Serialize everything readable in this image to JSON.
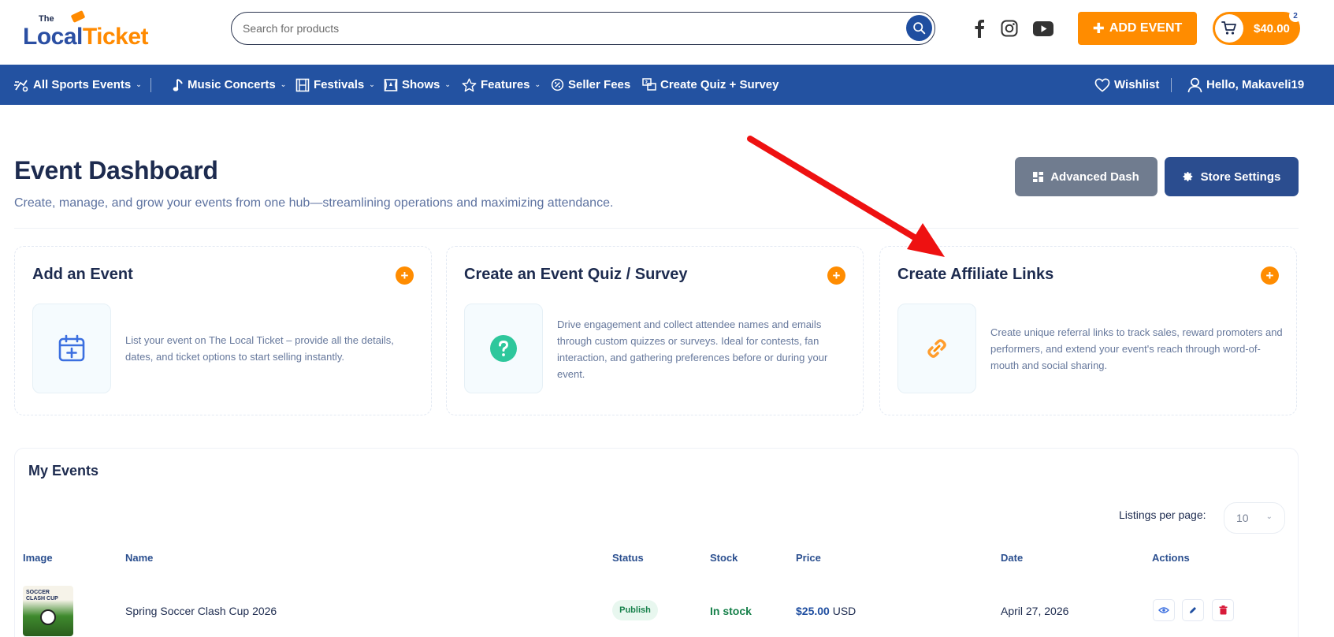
{
  "header": {
    "logo_the": "The",
    "logo_local": "Local",
    "logo_ticket": "Ticket",
    "search_placeholder": "Search for products",
    "add_event_label": "ADD EVENT",
    "cart_amount": "$40.00",
    "cart_count": "2"
  },
  "nav": {
    "items": [
      {
        "label": "All Sports Events",
        "icon": "sports-icon",
        "dropdown": true
      },
      {
        "label": "Music Concerts",
        "icon": "music-note-icon",
        "dropdown": true
      },
      {
        "label": "Festivals",
        "icon": "film-icon",
        "dropdown": true
      },
      {
        "label": "Shows",
        "icon": "theater-icon",
        "dropdown": true
      },
      {
        "label": "Features",
        "icon": "star-icon",
        "dropdown": true
      },
      {
        "label": "Seller Fees",
        "icon": "badge-icon",
        "dropdown": false
      },
      {
        "label": "Create Quiz + Survey",
        "icon": "quiz-icon",
        "dropdown": false
      }
    ],
    "wishlist_label": "Wishlist",
    "user_label": "Hello, Makaveli19"
  },
  "page": {
    "title": "Event Dashboard",
    "subtitle": "Create, manage, and grow your events from one hub—streamlining operations and maximizing attendance.",
    "advanced_dash_label": "Advanced Dash",
    "store_settings_label": "Store Settings"
  },
  "cards": [
    {
      "title": "Add an Event",
      "description": "List your event on The Local Ticket – provide all the details, dates, and ticket options to start selling instantly.",
      "icon": "calendar-plus-icon"
    },
    {
      "title": "Create an Event Quiz / Survey",
      "description": "Drive engagement and collect attendee names and emails through custom quizzes or surveys. Ideal for contests, fan interaction, and gathering preferences before or during your event.",
      "icon": "question-icon"
    },
    {
      "title": "Create Affiliate Links",
      "description": "Create unique referral links to track sales, reward promoters and performers, and extend your event's reach through word-of-mouth and social sharing.",
      "icon": "link-icon"
    }
  ],
  "events": {
    "title": "My Events",
    "listings_label": "Listings per page:",
    "listings_value": "10",
    "columns": [
      "Image",
      "Name",
      "Status",
      "Stock",
      "Price",
      "Date",
      "Actions"
    ],
    "rows": [
      {
        "thumb_text": "SOCCER CLASH CUP",
        "name": "Spring Soccer Clash Cup 2026",
        "status": "Publish",
        "stock": "In stock",
        "price": "$25.00",
        "currency": "USD",
        "date": "April 27, 2026"
      }
    ]
  },
  "colors": {
    "brand_blue": "#2352a1",
    "brand_orange": "#ff8c00",
    "annotation_arrow": "#ee1111"
  }
}
